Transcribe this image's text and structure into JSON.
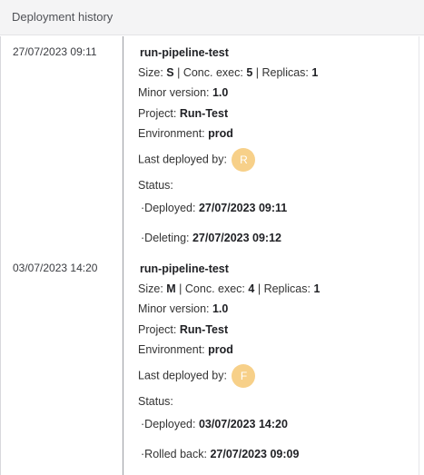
{
  "header": {
    "title": "Deployment history"
  },
  "entries": [
    {
      "date": "27/07/2023 09:11",
      "name": "run-pipeline-test",
      "size_label": "Size:",
      "size": "S",
      "conc_label": "Conc. exec:",
      "conc": "5",
      "replicas_label": "Replicas:",
      "replicas": "1",
      "minor_label": "Minor version:",
      "minor": "1.0",
      "project_label": "Project:",
      "project": "Run-Test",
      "env_label": "Environment:",
      "env": "prod",
      "deployed_by_label": "Last deployed by:",
      "avatar_initial": "R",
      "status_label": "Status:",
      "status": [
        {
          "label": "·Deployed:",
          "value": "27/07/2023 09:11"
        },
        {
          "label": "·Deleting:",
          "value": "27/07/2023 09:12"
        }
      ]
    },
    {
      "date": "03/07/2023 14:20",
      "name": "run-pipeline-test",
      "size_label": "Size:",
      "size": "M",
      "conc_label": "Conc. exec:",
      "conc": "4",
      "replicas_label": "Replicas:",
      "replicas": "1",
      "minor_label": "Minor version:",
      "minor": "1.0",
      "project_label": "Project:",
      "project": "Run-Test",
      "env_label": "Environment:",
      "env": "prod",
      "deployed_by_label": "Last deployed by:",
      "avatar_initial": "F",
      "status_label": "Status:",
      "status": [
        {
          "label": "·Deployed:",
          "value": "03/07/2023 14:20"
        },
        {
          "label": "·Rolled back:",
          "value": "27/07/2023 09:09"
        }
      ]
    }
  ],
  "colors": {
    "avatar": "#f7d089",
    "header_bg": "#f4f4f5",
    "divider": "#9a9ca2"
  }
}
